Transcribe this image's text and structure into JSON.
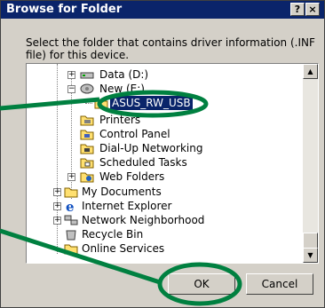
{
  "window": {
    "title": "Browse for Folder",
    "help_label": "?",
    "close_label": "×"
  },
  "instructions": "Select the folder that contains driver information (.INF file) for this device.",
  "tree": {
    "items": [
      {
        "label": "Data (D:)",
        "icon": "drive-icon"
      },
      {
        "label": "New (E:)",
        "icon": "removable-drive-icon"
      },
      {
        "label": "ASUS_RW_USB",
        "icon": "folder-icon",
        "selected": true
      },
      {
        "label": "Printers",
        "icon": "printers-icon"
      },
      {
        "label": "Control Panel",
        "icon": "control-panel-icon"
      },
      {
        "label": "Dial-Up Networking",
        "icon": "dialup-icon"
      },
      {
        "label": "Scheduled Tasks",
        "icon": "scheduled-tasks-icon"
      },
      {
        "label": "Web Folders",
        "icon": "web-folders-icon"
      },
      {
        "label": "My Documents",
        "icon": "my-documents-icon"
      },
      {
        "label": "Internet Explorer",
        "icon": "internet-explorer-icon"
      },
      {
        "label": "Network Neighborhood",
        "icon": "network-icon"
      },
      {
        "label": "Recycle Bin",
        "icon": "recycle-bin-icon"
      },
      {
        "label": "Online Services",
        "icon": "folder-icon"
      }
    ]
  },
  "scrollbar": {
    "up_label": "▲",
    "down_label": "▼"
  },
  "buttons": {
    "ok_label": "OK",
    "cancel_label": "Cancel"
  },
  "colors": {
    "highlight": "#0a246a",
    "callout": "#008040",
    "face": "#d4d0c8"
  }
}
